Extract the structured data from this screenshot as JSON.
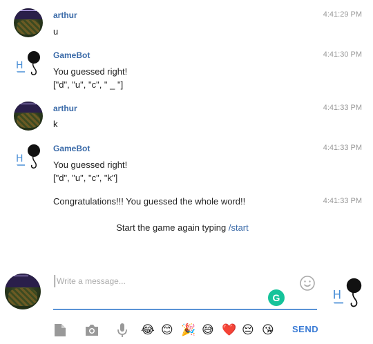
{
  "messages": [
    {
      "sender": "arthur",
      "time": "4:41:29 PM",
      "lines": [
        "u"
      ]
    },
    {
      "sender": "GameBot",
      "time": "4:41:30 PM",
      "lines": [
        "You guessed right!",
        "[\"d\", \"u\", \"c\", \" _ \"]"
      ]
    },
    {
      "sender": "arthur",
      "time": "4:41:33 PM",
      "lines": [
        "k"
      ]
    },
    {
      "sender": "GameBot",
      "time": "4:41:33 PM",
      "lines": [
        "You guessed right!",
        "[\"d\", \"u\", \"c\", \"k\"]"
      ]
    },
    {
      "sender": "",
      "time": "4:41:33 PM",
      "lines": [
        "Congratulations!!! You guessed the whole word!!"
      ]
    }
  ],
  "system": {
    "text": "Start the game again typing ",
    "command": "/start"
  },
  "composer": {
    "placeholder": "Write a message...",
    "send_label": "SEND"
  },
  "toolbar": {
    "icons": [
      "file-icon",
      "camera-icon",
      "microphone-icon"
    ],
    "emojis": [
      "😂",
      "😊",
      "🎉",
      "😅",
      "❤️",
      "😔",
      "😘"
    ]
  },
  "colors": {
    "sender": "#3a6aa8",
    "accent": "#3a7bd5",
    "underline": "#5a93d6",
    "grammarly": "#15c39a"
  }
}
